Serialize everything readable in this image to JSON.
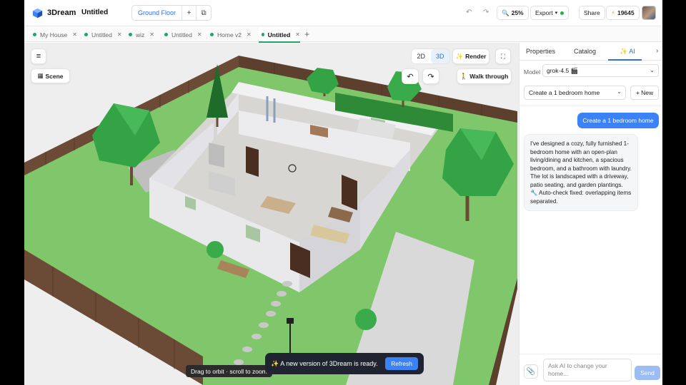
{
  "app": {
    "brand": "3Dream",
    "doc_title": "Untitled"
  },
  "toolbar": {
    "floor_label": "Ground Floor",
    "add_floor": "+",
    "undo_icon": "↶",
    "redo_icon": "↷",
    "zoom": "25%",
    "export_label": "Export",
    "share_label": "Share",
    "credits": "19645"
  },
  "tabs": [
    {
      "label": "My House",
      "active": false
    },
    {
      "label": "Untitled",
      "active": false
    },
    {
      "label": "wiz",
      "active": false
    },
    {
      "label": "Untitled",
      "active": false
    },
    {
      "label": "Home v2",
      "active": false
    },
    {
      "label": "Untitled",
      "active": true
    }
  ],
  "viewport": {
    "scene_label": "Scene",
    "view_2d": "2D",
    "view_3d": "3D",
    "render_label": "Render",
    "walk_label": "Walk through",
    "hint": "Drag to orbit · scroll to zoom",
    "toast_text": "✨ A new version of 3Dream is ready.",
    "toast_refresh": "Refresh"
  },
  "panel": {
    "tabs": [
      "Properties",
      "Catalog",
      "✨ AI"
    ],
    "model_label": "Model",
    "model_value": "grok-4.5 🎬",
    "conversation": "Create a 1 bedroom home",
    "new_label": "+ New",
    "user_message": "Create a 1 bedroom home",
    "ai_message": "I've designed a cozy, fully furnished 1-bedroom home with an open-plan living/dining and kitchen, a spacious bedroom, and a bathroom with laundry. The lot is landscaped with a driveway, patio seating, and garden plantings.",
    "ai_fix": "🔧 Auto-check fixed: overlapping items separated.",
    "input_placeholder": "Ask AI to change your home...",
    "send_label": "Send"
  },
  "colors": {
    "accent": "#3b82f6",
    "grass": "#7fc76a",
    "fence": "#6b4a36",
    "wall": "#e8e8ec",
    "floor": "#c9c7c2",
    "tree": "#2f9c3c"
  }
}
